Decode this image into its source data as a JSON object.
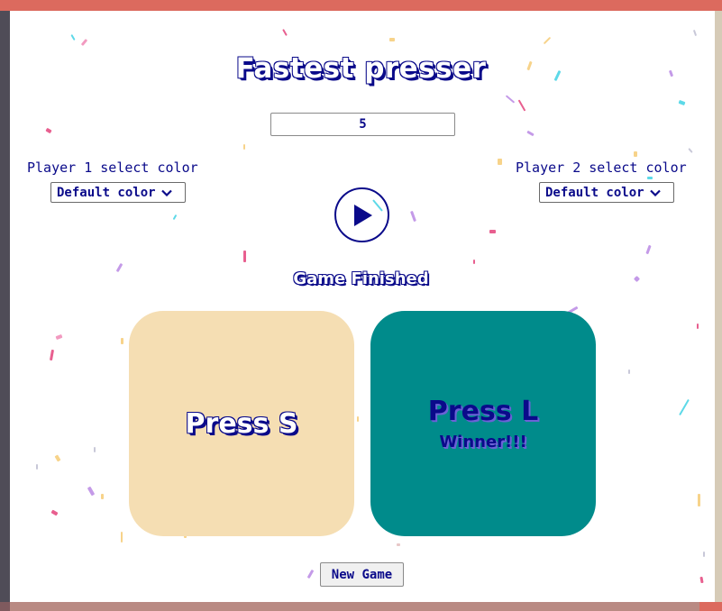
{
  "game": {
    "title": "Fastest presser",
    "rounds_value": "5",
    "status": "Game Finished",
    "new_game_label": "New Game",
    "play_icon": "play-icon"
  },
  "players": [
    {
      "select_label": "Player 1 select color",
      "color_value": "Default color",
      "pad_label": "Press S",
      "pad_color": "#f5deb3",
      "result": ""
    },
    {
      "select_label": "Player 2 select color",
      "color_value": "Default color",
      "pad_label": "Press L",
      "pad_color": "#008b8b",
      "result": "Winner!!!"
    }
  ],
  "colors": {
    "text_accent": "#0a0a8a",
    "frame_top": "#dc6a5e",
    "frame_left": "#4f4c57",
    "frame_right": "#d6cbb7"
  }
}
